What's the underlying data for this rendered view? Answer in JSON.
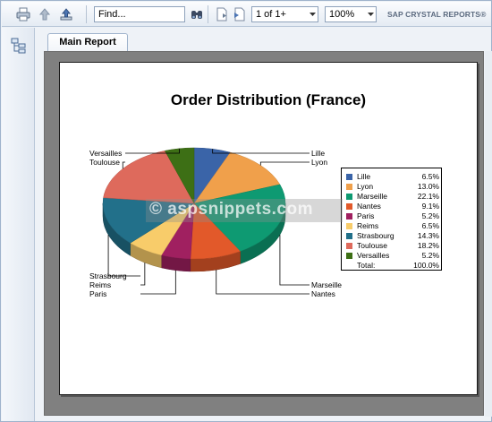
{
  "toolbar": {
    "find_value": "Find...",
    "page_value": "1 of 1+",
    "zoom_value": "100%",
    "brand": "SAP CRYSTAL REPORTS®"
  },
  "tabs": [
    {
      "label": "Main Report"
    }
  ],
  "report": {
    "watermark": "© aspsnippets.com"
  },
  "chart_data": {
    "type": "pie",
    "title": "Order Distribution (France)",
    "categories": [
      "Lille",
      "Lyon",
      "Marseille",
      "Nantes",
      "Paris",
      "Reims",
      "Strasbourg",
      "Toulouse",
      "Versailles"
    ],
    "values": [
      6.5,
      13.0,
      22.1,
      9.1,
      5.2,
      6.5,
      14.3,
      18.2,
      5.2
    ],
    "percent_labels": [
      "6.5%",
      "13.0%",
      "22.1%",
      "9.1%",
      "5.2%",
      "6.5%",
      "14.3%",
      "18.2%",
      "5.2%"
    ],
    "colors": [
      "#3a64a8",
      "#f0a04b",
      "#0e9a72",
      "#e2592a",
      "#a02060",
      "#f8cc6a",
      "#22708a",
      "#de6a5c",
      "#3d6f15"
    ],
    "legend": {
      "placement": "right",
      "total_label": "Total:",
      "total_value": "100.0%"
    },
    "three_d": true
  }
}
